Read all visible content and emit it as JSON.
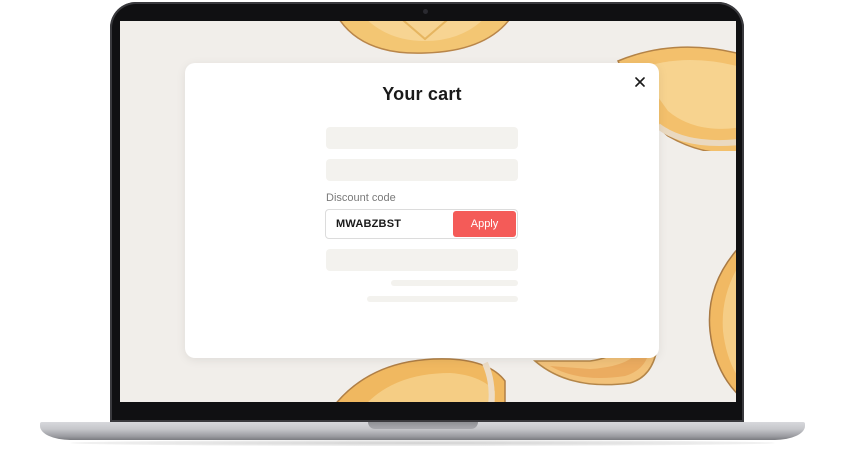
{
  "cart": {
    "title": "Your cart",
    "discount": {
      "label": "Discount code",
      "value": "MWABZBST",
      "apply_label": "Apply"
    }
  },
  "colors": {
    "accent": "#f45b58",
    "backdrop": "#f1eeea",
    "placeholder": "#f3f2ee"
  },
  "icons": {
    "close": "close-icon"
  }
}
